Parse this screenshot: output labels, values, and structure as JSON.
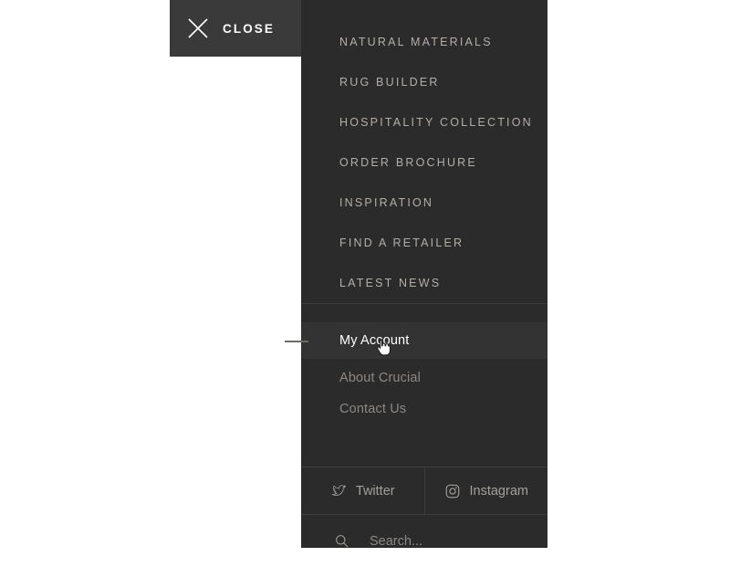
{
  "close_bar": {
    "label": "CLOSE",
    "icon": "close-x-icon",
    "background": "#3a3a3a"
  },
  "panel": {
    "background": "#2b2b2b",
    "accent_text": "#b3aea8",
    "active_background": "#333333",
    "divider": "#3d3d3d"
  },
  "primary_nav": {
    "items": [
      {
        "label": "NATURAL MATERIALS"
      },
      {
        "label": "RUG BUILDER"
      },
      {
        "label": "HOSPITALITY COLLECTION"
      },
      {
        "label": "ORDER BROCHURE"
      },
      {
        "label": "INSPIRATION"
      },
      {
        "label": "FIND A RETAILER"
      },
      {
        "label": "LATEST NEWS"
      }
    ]
  },
  "secondary_nav": {
    "items": [
      {
        "label": "My Account",
        "active": true
      },
      {
        "label": "About Crucial",
        "active": false
      },
      {
        "label": "Contact Us",
        "active": false
      }
    ]
  },
  "social": {
    "items": [
      {
        "label": "Twitter",
        "icon": "twitter-icon"
      },
      {
        "label": "Instagram",
        "icon": "instagram-icon"
      }
    ]
  },
  "search": {
    "placeholder": "Search...",
    "value": "",
    "icon": "search-icon"
  },
  "cursor": {
    "type": "pointer-hand-cursor"
  }
}
